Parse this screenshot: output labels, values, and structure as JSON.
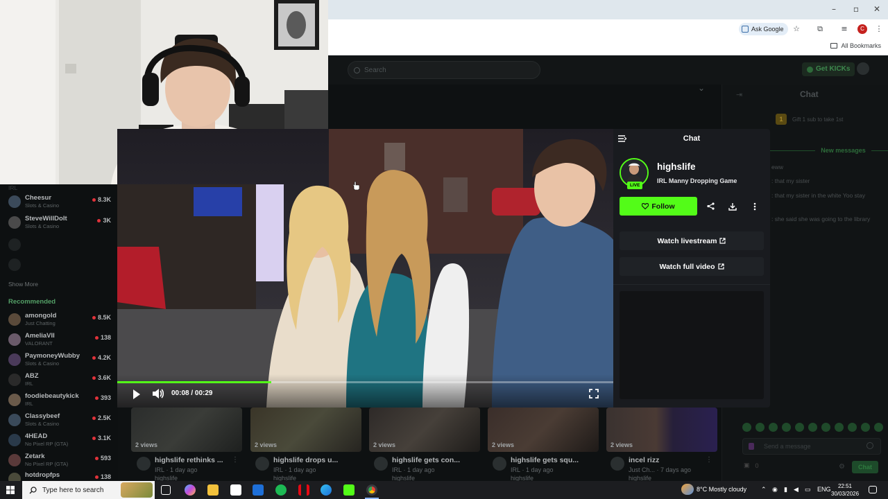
{
  "browser": {
    "ask_google_label": "Ask Google",
    "profile_initial": "C",
    "all_bookmarks_label": "All Bookmarks"
  },
  "kick": {
    "search_placeholder": "Search",
    "get_kicks_label": "Get KICKs",
    "chat_title": "Chat",
    "gift_text": "Gift 1 sub to take 1st",
    "gift_count": "1",
    "new_messages_label": "New messages",
    "messages": [
      "eww",
      ": that my sister",
      ": that my sister in the white Yoo stay",
      ": she said she was going to the library"
    ],
    "send_placeholder": "Send a message",
    "points": "0",
    "chat_button": "Chat"
  },
  "sidebar": {
    "top_category": "IRL",
    "following": [
      {
        "name": "Cheesur",
        "category": "Slots & Casino",
        "viewers": "8.3K"
      },
      {
        "name": "SteveWillDoIt",
        "category": "Slots & Casino",
        "viewers": "3K"
      }
    ],
    "show_more_label": "Show More",
    "recommended_heading": "Recommended",
    "recommended": [
      {
        "name": "amongold",
        "category": "Just Chatting",
        "viewers": "8.5K"
      },
      {
        "name": "AmeliaVII",
        "category": "VALORANT",
        "viewers": "138"
      },
      {
        "name": "PaymoneyWubby",
        "category": "Slots & Casino",
        "viewers": "4.2K"
      },
      {
        "name": "ABZ",
        "category": "IRL",
        "viewers": "3.6K"
      },
      {
        "name": "foodiebeautykick",
        "category": "IRL",
        "viewers": "393"
      },
      {
        "name": "Classybeef",
        "category": "Slots & Casino",
        "viewers": "2.5K"
      },
      {
        "name": "4HEAD",
        "category": "No Pixel RP (GTA)",
        "viewers": "3.1K"
      },
      {
        "name": "Zetark",
        "category": "No Pixel RP (GTA)",
        "viewers": "593"
      },
      {
        "name": "hotdropfps",
        "category": "",
        "viewers": "138"
      }
    ]
  },
  "player": {
    "time": "00:08 / 00:29",
    "progress": 0.31
  },
  "popup": {
    "title": "Chat",
    "channel_name": "highslife",
    "stream_title": "IRL Manny Dropping Game",
    "live_label": "LIVE",
    "follow_label": "Follow",
    "watch_livestream_label": "Watch livestream",
    "watch_full_video_label": "Watch full video"
  },
  "videos": [
    {
      "views": "2 views",
      "title": "highslife rethinks ...",
      "category": "IRL",
      "age": "1 day ago",
      "channel": "highslife"
    },
    {
      "views": "2 views",
      "title": "highslife drops u...",
      "category": "IRL",
      "age": "1 day ago",
      "channel": "highslife"
    },
    {
      "views": "2 views",
      "title": "highslife gets con...",
      "category": "IRL",
      "age": "1 day ago",
      "channel": "highslife"
    },
    {
      "views": "2 views",
      "title": "highslife gets squ...",
      "category": "IRL",
      "age": "1 day ago",
      "channel": "highslife"
    },
    {
      "views": "2 views",
      "title": "incel rizz",
      "category": "Just Ch...",
      "age": "7 days ago",
      "channel": "highslife"
    }
  ],
  "taskbar": {
    "search_placeholder": "Type here to search",
    "weather": "8°C  Mostly cloudy",
    "language": "ENG",
    "time": "22:51",
    "date": "30/03/2026"
  },
  "colors": {
    "kick_green": "#53fc18",
    "live_red": "#e0323a",
    "popup_bg": "#191b1f"
  }
}
